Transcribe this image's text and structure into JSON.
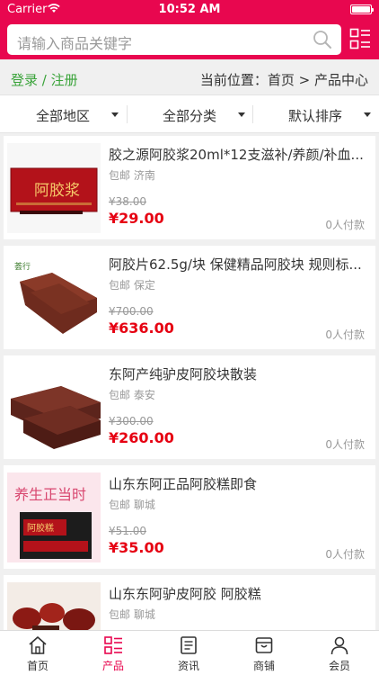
{
  "status_bar": {
    "carrier": "Carrier",
    "time": "10:52 AM"
  },
  "search": {
    "placeholder": "请输入商品关键字"
  },
  "location": {
    "login_text": "登录 / 注册",
    "breadcrumb": "当前位置：首页 > 产品中心"
  },
  "filters": [
    {
      "label": "全部地区"
    },
    {
      "label": "全部分类"
    },
    {
      "label": "默认排序"
    }
  ],
  "products": [
    {
      "title": "胶之源阿胶浆20ml*12支滋补/养颜/补血...",
      "shipping": "包邮",
      "city": "济南",
      "original_price": "¥38.00",
      "price": "¥29.00",
      "paid": "0人付款",
      "image": "red-box-ejiao-syrup"
    },
    {
      "title": "阿胶片62.5g/块 保健精品阿胶块 规则标...",
      "shipping": "包邮",
      "city": "保定",
      "original_price": "¥700.00",
      "price": "¥636.00",
      "paid": "0人付款",
      "image": "ejiao-slices"
    },
    {
      "title": "东阿产纯驴皮阿胶块散装",
      "shipping": "包邮",
      "city": "泰安",
      "original_price": "¥300.00",
      "price": "¥260.00",
      "paid": "0人付款",
      "image": "ejiao-blocks"
    },
    {
      "title": "山东东阿正品阿胶糕即食",
      "shipping": "包邮",
      "city": "聊城",
      "original_price": "¥51.00",
      "price": "¥35.00",
      "paid": "0人付款",
      "image": "ejiao-cake-box"
    },
    {
      "title": "山东东阿驴皮阿胶 阿胶糕",
      "shipping": "包邮",
      "city": "聊城",
      "original_price": "",
      "price": "",
      "paid": "",
      "image": "ejiao-cake-dates"
    }
  ],
  "tabs": [
    {
      "label": "首页",
      "icon": "home-icon",
      "active": false
    },
    {
      "label": "产品",
      "icon": "product-list-icon",
      "active": true
    },
    {
      "label": "资讯",
      "icon": "news-icon",
      "active": false
    },
    {
      "label": "商铺",
      "icon": "store-icon",
      "active": false
    },
    {
      "label": "会员",
      "icon": "member-icon",
      "active": false
    }
  ],
  "colors": {
    "brand": "#e8074f",
    "price": "#e60012",
    "login": "#3aa33a"
  }
}
